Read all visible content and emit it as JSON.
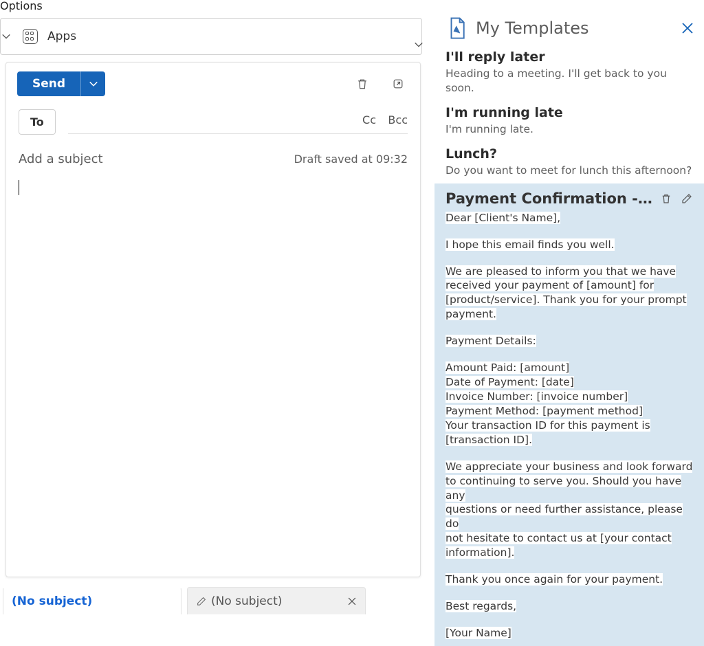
{
  "ribbon": {
    "tab": "Options",
    "apps_label": "Apps"
  },
  "compose": {
    "send_label": "Send",
    "to_label": "To",
    "cc_label": "Cc",
    "bcc_label": "Bcc",
    "subject_placeholder": "Add a subject",
    "draft_status": "Draft saved at 09:32"
  },
  "panel": {
    "title": "My Templates",
    "templates": [
      {
        "title": "I'll reply later",
        "preview": "Heading to a meeting. I'll get back to you soon."
      },
      {
        "title": "I'm running late",
        "preview": "I'm running late."
      },
      {
        "title": "Lunch?",
        "preview": "Do you want to meet for lunch this afternoon?"
      }
    ],
    "selected": {
      "title": "Payment Confirmation - Than...",
      "lines": {
        "l1": "Dear [Client's Name],",
        "l2": "I hope this email finds you well.",
        "l3a": "We are pleased to inform you that we have",
        "l3b": "received your payment of [amount] for",
        "l3c": "[product/service]. Thank you for your prompt",
        "l3d": "payment.",
        "l4": "Payment Details:",
        "l5": "Amount Paid: [amount]",
        "l6": "Date of Payment: [date]",
        "l7": "Invoice Number: [invoice number]",
        "l8": "Payment Method: [payment method]",
        "l9a": "Your transaction ID for this payment is",
        "l9b": "[transaction ID].",
        "l10a": "We appreciate your business and look forward",
        "l10b": "to continuing to serve you. Should you have any",
        "l10c": "questions or need further assistance, please do",
        "l10d": "not hesitate to contact us at [your contact",
        "l10e": "information].",
        "l11": "Thank you once again for your payment.",
        "l12": "Best regards,",
        "l13": "[Your Name]"
      }
    }
  },
  "tabs": {
    "t1": "(No subject)",
    "t2": "(No subject)"
  }
}
